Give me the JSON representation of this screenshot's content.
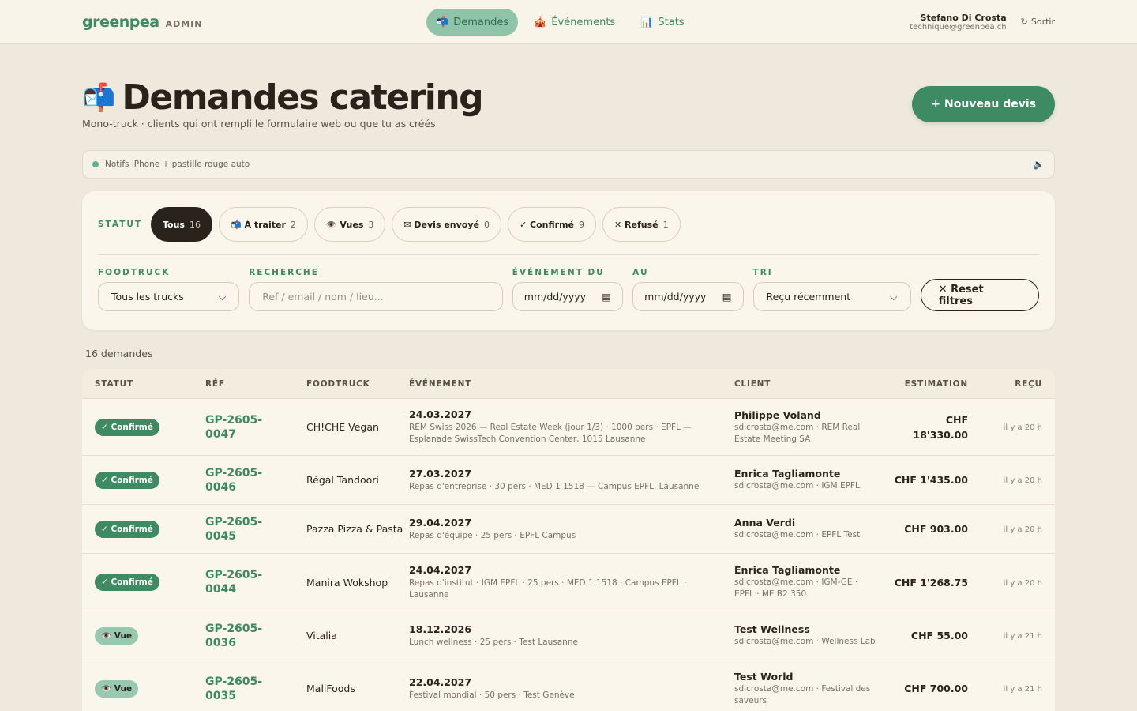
{
  "brand": {
    "name": "greenpea",
    "tag": "ADMIN"
  },
  "nav": [
    {
      "icon": "📬",
      "label": "Demandes"
    },
    {
      "icon": "🎪",
      "label": "Événements"
    },
    {
      "icon": "📊",
      "label": "Stats"
    }
  ],
  "user": {
    "name": "Stefano Di Crosta",
    "email": "technique@greenpea.ch",
    "logout": "Sortir",
    "logout_icon": "↻"
  },
  "header": {
    "icon": "📬",
    "title": "Demandes catering",
    "subtitle": "Mono-truck · clients qui ont rempli le formulaire web ou que tu as créés",
    "new_button": "+ Nouveau devis"
  },
  "notif": {
    "text": "Notifs iPhone + pastille rouge auto",
    "speaker_icon": "🔈"
  },
  "filters": {
    "status_label": "STATUT",
    "pills": [
      {
        "label": "Tous",
        "count": "16"
      },
      {
        "label": "📬 À traiter",
        "count": "2"
      },
      {
        "label": "👁️ Vues",
        "count": "3"
      },
      {
        "label": "✉ Devis envoyé",
        "count": "0"
      },
      {
        "label": "✓ Confirmé",
        "count": "9"
      },
      {
        "label": "✕ Refusé",
        "count": "1"
      }
    ],
    "foodtruck": {
      "label": "FOODTRUCK",
      "value": "Tous les trucks"
    },
    "search": {
      "label": "RECHERCHE",
      "placeholder": "Ref / email / nom / lieu..."
    },
    "from": {
      "label": "ÉVÉNEMENT DU",
      "value": "mm/dd/yyyy"
    },
    "to": {
      "label": "AU",
      "value": "mm/dd/yyyy"
    },
    "sort": {
      "label": "TRI",
      "value": "Reçu récemment"
    },
    "reset": "✕ Reset filtres"
  },
  "count_text": "16 demandes",
  "table": {
    "headers": [
      "STATUT",
      "RÉF",
      "FOODTRUCK",
      "ÉVÉNEMENT",
      "CLIENT",
      "ESTIMATION",
      "REÇU"
    ],
    "rows": [
      {
        "status": "✓ Confirmé",
        "kind": "ok",
        "ref1": "GP-2605-",
        "ref2": "0047",
        "truck": "CH!CHE Vegan",
        "date": "24.03.2027",
        "desc": "REM Swiss 2026 — Real Estate Week (jour 1/3) · 1000 pers · EPFL — Esplanade SwissTech Convention Center, 1015 Lausanne",
        "client": "Philippe Voland",
        "client_desc": "sdicrosta@me.com · REM Real Estate Meeting SA",
        "est": "CHF 18'330.00",
        "recv": "il y a 20 h"
      },
      {
        "status": "✓ Confirmé",
        "kind": "ok",
        "ref1": "GP-2605-",
        "ref2": "0046",
        "truck": "Régal Tandoori",
        "date": "27.03.2027",
        "desc": "Repas d'entreprise · 30 pers · MED 1 1518 — Campus EPFL, Lausanne",
        "client": "Enrica Tagliamonte",
        "client_desc": "sdicrosta@me.com · IGM EPFL",
        "est": "CHF 1'435.00",
        "recv": "il y a 20 h"
      },
      {
        "status": "✓ Confirmé",
        "kind": "ok",
        "ref1": "GP-2605-",
        "ref2": "0045",
        "truck": "Pazza Pizza & Pasta",
        "date": "29.04.2027",
        "desc": "Repas d'équipe · 25 pers · EPFL Campus",
        "client": "Anna Verdi",
        "client_desc": "sdicrosta@me.com · EPFL Test",
        "est": "CHF 903.00",
        "recv": "il y a 20 h"
      },
      {
        "status": "✓ Confirmé",
        "kind": "ok",
        "ref1": "GP-2605-",
        "ref2": "0044",
        "truck": "Manira Wokshop",
        "date": "24.04.2027",
        "desc": "Repas d'institut · IGM EPFL · 25 pers · MED 1 1518 · Campus EPFL · Lausanne",
        "client": "Enrica Tagliamonte",
        "client_desc": "sdicrosta@me.com · IGM-GE · EPFL · ME B2 350",
        "est": "CHF 1'268.75",
        "recv": "il y a 20 h"
      },
      {
        "status": "👁️ Vue",
        "kind": "seen",
        "ref1": "GP-2605-",
        "ref2": "0036",
        "truck": "Vitalia",
        "date": "18.12.2026",
        "desc": "Lunch wellness · 25 pers · Test Lausanne",
        "client": "Test Wellness",
        "client_desc": "sdicrosta@me.com · Wellness Lab",
        "est": "CHF 55.00",
        "recv": "il y a 21 h"
      },
      {
        "status": "👁️ Vue",
        "kind": "seen",
        "ref1": "GP-2605-",
        "ref2": "0035",
        "truck": "MaliFoods",
        "date": "22.04.2027",
        "desc": "Festival mondial · 50 pers · Test Genève",
        "client": "Test World",
        "client_desc": "sdicrosta@me.com · Festival des saveurs",
        "est": "CHF 700.00",
        "recv": "il y a 21 h"
      }
    ]
  }
}
